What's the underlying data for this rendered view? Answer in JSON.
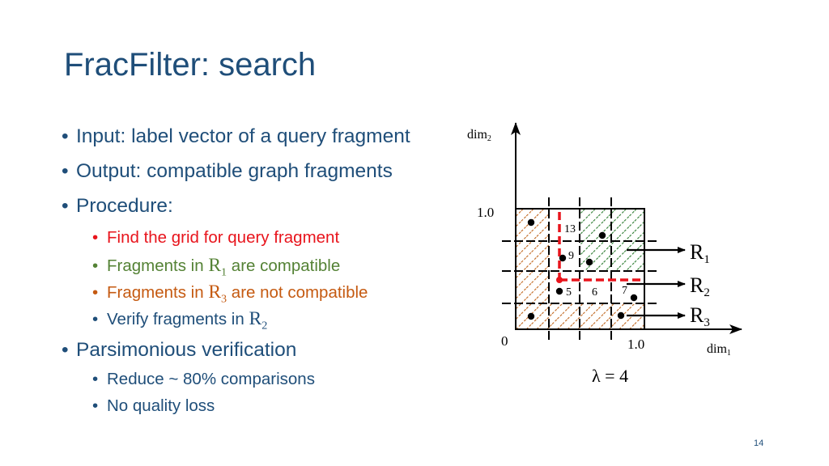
{
  "slide": {
    "title": "FracFilter: search",
    "page_number": "14"
  },
  "bullets": [
    {
      "text": "Input: label vector of a query fragment"
    },
    {
      "text": "Output: compatible graph fragments"
    },
    {
      "text": "Procedure:"
    },
    {
      "text": "Find the grid for query fragment",
      "color": "#e8141c"
    },
    {
      "prefix": "Fragments in ",
      "symbol": "R",
      "sub": "1",
      "suffix": " are compatible",
      "color": "#548235"
    },
    {
      "prefix": "Fragments in ",
      "symbol": "R",
      "sub": "3",
      "suffix": " are not compatible",
      "color": "#c55a11"
    },
    {
      "prefix": "Verify fragments in ",
      "symbol": "R",
      "sub": "2",
      "suffix": "",
      "color": "#1f4e79"
    },
    {
      "text": "Parsimonious verification"
    },
    {
      "text": "Reduce ~ 80% comparisons"
    },
    {
      "text": "No quality loss"
    }
  ],
  "diagram": {
    "y_axis_label": "dim",
    "y_axis_sub": "2",
    "x_axis_label": "dim",
    "x_axis_sub": "1",
    "origin_label": "0",
    "y_max_label": "1.0",
    "x_max_label": "1.0",
    "lambda_label": "λ = 4",
    "grid_size": 4,
    "region_labels": [
      {
        "symbol": "R",
        "sub": "1"
      },
      {
        "symbol": "R",
        "sub": "2"
      },
      {
        "symbol": "R",
        "sub": "3"
      }
    ],
    "cell_numbers": [
      "13",
      "9",
      "5",
      "6",
      "7"
    ],
    "colors": {
      "compatible": "#2e7d32",
      "not_compatible": "#c0661e",
      "query_boundary": "#e8141c",
      "axis": "#000000"
    }
  }
}
